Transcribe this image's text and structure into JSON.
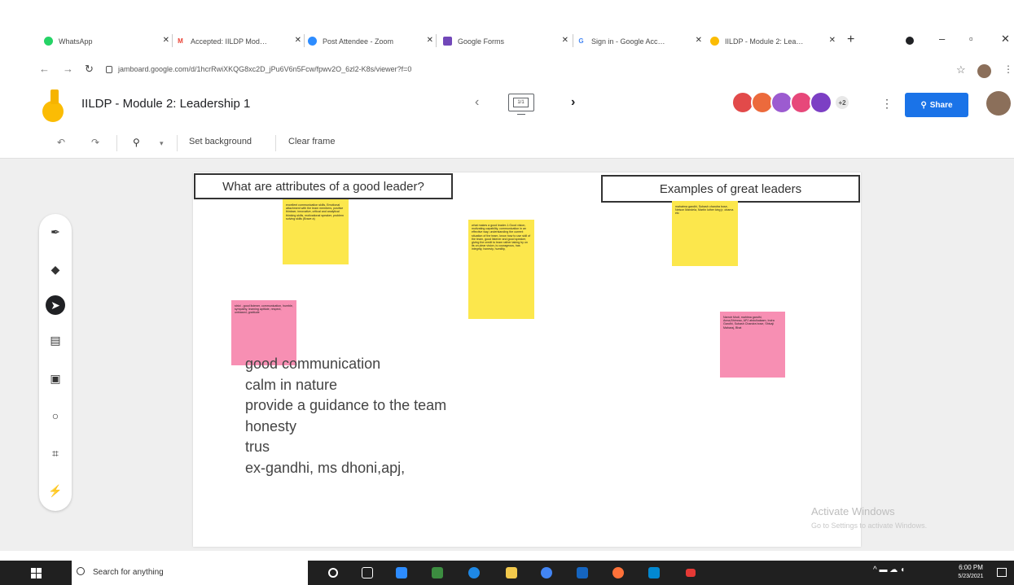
{
  "browser": {
    "tabs": [
      {
        "label": "WhatsApp",
        "favicon_color": "#25d366",
        "favicon_glyph": "●"
      },
      {
        "label": "Accepted: IILDP Mod…",
        "favicon_color": "#ea4335",
        "favicon_glyph": "M"
      },
      {
        "label": "Post Attendee - Zoom",
        "favicon_color": "#2d8cff",
        "favicon_glyph": "▢"
      },
      {
        "label": "Google Forms",
        "favicon_color": "#7248b9",
        "favicon_glyph": "▤"
      },
      {
        "label": "Sign in - Google Acc…",
        "favicon_color": "#4285f4",
        "favicon_glyph": "G"
      },
      {
        "label": "IILDP - Module 2: Lea…",
        "favicon_color": "#fbbc04",
        "favicon_glyph": "J"
      }
    ],
    "new_tab_glyph": "+",
    "window_controls": {
      "minimize": "–",
      "maximize": "▫",
      "close": "✕"
    },
    "url": "jamboard.google.com/d/1hcrRwiXKQG8xc2D_jPu6V6n5Fcw/fpwv2O_6zl2-K8s/viewer?f=0"
  },
  "app": {
    "title": "IILDP - Module 2: Leadership 1",
    "frame_indicator": "1/1",
    "collaborator_more": "+2",
    "share_label": "Share",
    "brand_color": "#1a73e8"
  },
  "toolbar": {
    "set_background": "Set background",
    "clear_frame": "Clear frame"
  },
  "board": {
    "header_left": "What are attributes of a good leader?",
    "header_right": "Examples of great leaders",
    "stickies": [
      {
        "color": "yellow",
        "text": "excellent communication skills, Emotional attachment with the team members, positive thinkser, innovative, critical and analytical thinking skills, motivational speaker, problem solving skills (Brave a)"
      },
      {
        "color": "yellow",
        "text": "what makes a good leader-1.Good vision, motivating capability, communication in an effective way, understanding the current situation of the team, know how to use skill of the team, good listener and good speaker, giving the credit to team rather taking by on its on,clear vision, is courageous, has integrity, honesty, humility,"
      },
      {
        "color": "yellow",
        "text": "mahatma gandhi, Subash chandra bose, Nelson Mandela, Martin luther king jr, obama etc"
      },
      {
        "color": "pink",
        "text": "strict , good listener, communication, humble, sympathy, learning aptitute, respect, unbiased, gratitude"
      },
      {
        "color": "pink",
        "text": "Narndr Modi, mahtma gandhi, Anna,Bhimrao, APJ abdulkalaam, Indra Gandhi, Subash Chandra bose, Shivaji Maharaj, Bhat"
      }
    ],
    "text_lines": [
      "good communication",
      "calm in nature",
      "provide a guidance to the team",
      "honesty",
      "trus",
      "ex-gandhi, ms dhoni,apj,"
    ]
  },
  "watermark": {
    "line1": "Activate Windows",
    "line2": "Go to Settings to activate Windows."
  },
  "taskbar": {
    "search_placeholder": "Search for anything",
    "time": "6:00 PM",
    "date": "5/23/2021"
  }
}
